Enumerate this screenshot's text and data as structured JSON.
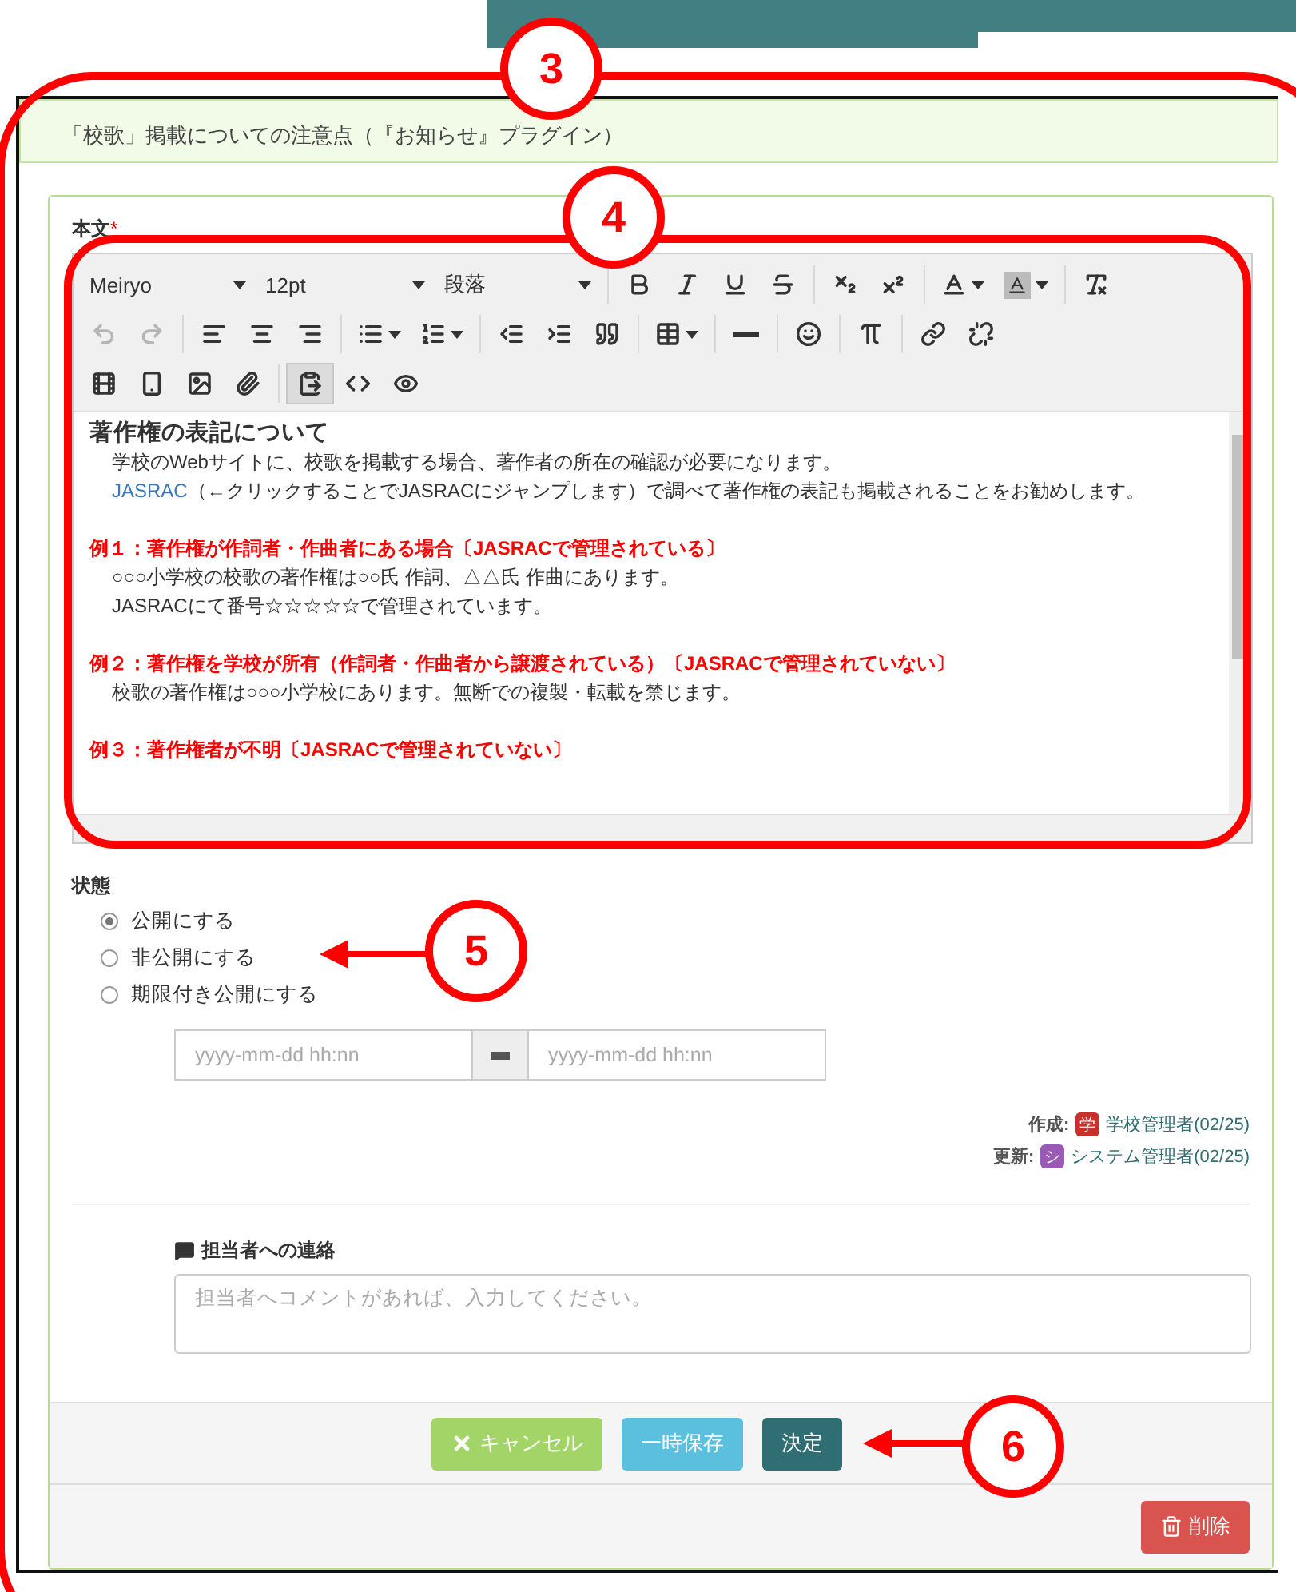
{
  "panel": {
    "title": "「校歌」掲載についての注意点（『お知らせ』プラグイン）"
  },
  "body_field": {
    "label": "本文",
    "required_mark": "*"
  },
  "toolbar": {
    "selects": [
      "Meiryo",
      "12pt",
      "段落"
    ],
    "rows": [
      [
        [
          {
            "kind": "bold",
            "disabled": false,
            "pressed": false
          },
          {
            "kind": "italic",
            "disabled": false,
            "pressed": false
          },
          {
            "kind": "underline",
            "disabled": false,
            "pressed": false
          },
          {
            "kind": "strike",
            "disabled": false,
            "pressed": false
          }
        ],
        [
          {
            "kind": "subscript",
            "disabled": false,
            "pressed": false
          },
          {
            "kind": "superscript",
            "disabled": false,
            "pressed": false
          }
        ],
        [
          {
            "kind": "text_color",
            "disabled": false,
            "pressed": false
          },
          {
            "kind": "bg_color",
            "disabled": false,
            "pressed": false
          }
        ],
        [
          {
            "kind": "clear_format",
            "disabled": false,
            "pressed": false
          }
        ]
      ],
      [
        [
          {
            "kind": "undo",
            "disabled": true,
            "pressed": false
          },
          {
            "kind": "redo",
            "disabled": true,
            "pressed": false
          }
        ],
        [
          {
            "kind": "align_left",
            "disabled": false,
            "pressed": false
          },
          {
            "kind": "align_center",
            "disabled": false,
            "pressed": false
          },
          {
            "kind": "align_right",
            "disabled": false,
            "pressed": false
          }
        ],
        [
          {
            "kind": "bullet_list",
            "disabled": false,
            "pressed": false
          },
          {
            "kind": "number_list",
            "disabled": false,
            "pressed": false
          }
        ],
        [
          {
            "kind": "outdent",
            "disabled": false,
            "pressed": false
          },
          {
            "kind": "indent",
            "disabled": false,
            "pressed": false
          },
          {
            "kind": "quote",
            "disabled": false,
            "pressed": false
          }
        ],
        [
          {
            "kind": "table",
            "disabled": false,
            "pressed": false
          }
        ],
        [
          {
            "kind": "hr",
            "disabled": false,
            "pressed": false
          }
        ],
        [
          {
            "kind": "emoji",
            "disabled": false,
            "pressed": false
          }
        ],
        [
          {
            "kind": "pi",
            "disabled": false,
            "pressed": false
          }
        ],
        [
          {
            "kind": "link",
            "disabled": false,
            "pressed": false
          },
          {
            "kind": "unlink",
            "disabled": false,
            "pressed": false
          }
        ]
      ],
      [
        [
          {
            "kind": "video",
            "disabled": false,
            "pressed": false
          },
          {
            "kind": "phone",
            "disabled": false,
            "pressed": false
          },
          {
            "kind": "image",
            "disabled": false,
            "pressed": false
          },
          {
            "kind": "attach",
            "disabled": false,
            "pressed": false
          }
        ],
        [
          {
            "kind": "paste",
            "disabled": false,
            "pressed": true
          },
          {
            "kind": "source",
            "disabled": false,
            "pressed": false
          },
          {
            "kind": "preview",
            "disabled": false,
            "pressed": false
          }
        ]
      ]
    ]
  },
  "content": [
    {
      "kind": "heading",
      "text": "著作権の表記について"
    },
    {
      "kind": "line",
      "text": "学校のWebサイトに、校歌を掲載する場合、著作者の所在の確認が必要になります。"
    },
    {
      "kind": "link_line",
      "link": "JASRAC",
      "text": "（←クリックすることでJASRACにジャンプします）で調べて著作権の表記も掲載されることをお勧めします。"
    },
    {
      "kind": "example",
      "text": "例１：著作権が作詞者・作曲者にある場合〔JASRACで管理されている〕"
    },
    {
      "kind": "line",
      "text": "○○○小学校の校歌の著作権は○○氏 作詞、△△氏 作曲にあります。"
    },
    {
      "kind": "line",
      "text": "JASRACにて番号☆☆☆☆☆で管理されています。"
    },
    {
      "kind": "example",
      "text": "例２：著作権を学校が所有（作詞者・作曲者から譲渡されている）〔JASRACで管理されていない〕"
    },
    {
      "kind": "line",
      "text": "校歌の著作権は○○○小学校にあります。無断での複製・転載を禁じます。"
    },
    {
      "kind": "example",
      "text": "例３：著作権者が不明〔JASRACで管理されていない〕"
    }
  ],
  "status": {
    "label": "状態",
    "options": [
      {
        "label": "公開にする",
        "selected": true
      },
      {
        "label": "非公開にする",
        "selected": false
      },
      {
        "label": "期限付き公開にする",
        "selected": false
      }
    ],
    "start_placeholder": "yyyy-mm-dd hh:nn",
    "end_placeholder": "yyyy-mm-dd hh:nn"
  },
  "meta": [
    {
      "label": "作成:",
      "badge": "学",
      "color": "#c9302c",
      "user": "学校管理者(02/25)"
    },
    {
      "label": "更新:",
      "badge": "シ",
      "color": "#9b59b6",
      "user": "システム管理者(02/25)"
    }
  ],
  "comment": {
    "label": "担当者への連絡",
    "placeholder": "担当者へコメントがあれば、入力してください。"
  },
  "buttons": [
    {
      "kind": "cancel",
      "label": "キャンセル"
    },
    {
      "kind": "draft",
      "label": "一時保存"
    },
    {
      "kind": "submit",
      "label": "決定"
    }
  ],
  "delete_button": {
    "label": "削除"
  },
  "annotations": [
    {
      "kind": "frame",
      "label": "3"
    },
    {
      "kind": "frame",
      "label": "4"
    },
    {
      "kind": "pointer",
      "label": "5"
    },
    {
      "kind": "pointer",
      "label": "6"
    }
  ]
}
